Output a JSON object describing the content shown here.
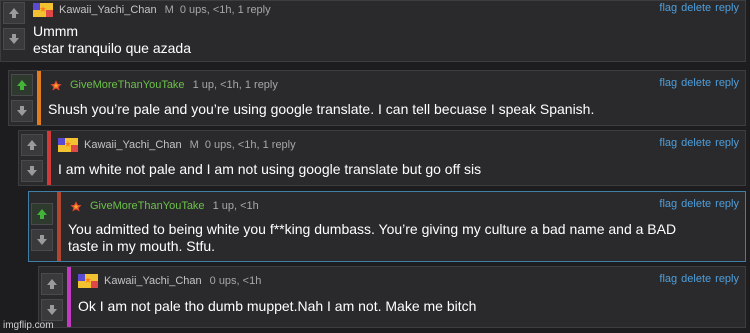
{
  "actions": {
    "flag": "flag",
    "delete": "delete",
    "reply": "reply"
  },
  "comments": [
    {
      "username": "Kawaii_Yachi_Chan",
      "tag": "M",
      "stats": "0 ups, <1h, 1 reply",
      "lines": [
        "Ummm",
        "estar tranquilo que azada"
      ]
    },
    {
      "username": "GiveMoreThanYouTake",
      "tag": "",
      "stats": "1 up, <1h, 1 reply",
      "lines": [
        "Shush you’re pale and you’re using google translate. I can tell becuase I speak Spanish."
      ]
    },
    {
      "username": "Kawaii_Yachi_Chan",
      "tag": "M",
      "stats": "0 ups, <1h, 1 reply",
      "lines": [
        "I am white not pale and I am not using google translate but go off sis"
      ]
    },
    {
      "username": "GiveMoreThanYouTake",
      "tag": "",
      "stats": "1 up, <1h",
      "lines": [
        "You admitted to being white you f**king dumbass. You’re giving my culture a bad name and a BAD",
        "taste in my mouth. Stfu."
      ]
    },
    {
      "username": "Kawaii_Yachi_Chan",
      "tag": "",
      "stats": "0 ups, <1h",
      "lines": [
        "Ok I am not pale tho dumb muppet.Nah I am not. Make me bitch"
      ]
    }
  ],
  "colors": {
    "bar_orange": "#e07d1f",
    "bar_red": "#d23a3a",
    "bar_brown": "#b1452e",
    "bar_magenta": "#c23ac2",
    "upvote_active": "#43b33a",
    "link": "#4f9edb"
  },
  "watermark": "imgflip.com"
}
